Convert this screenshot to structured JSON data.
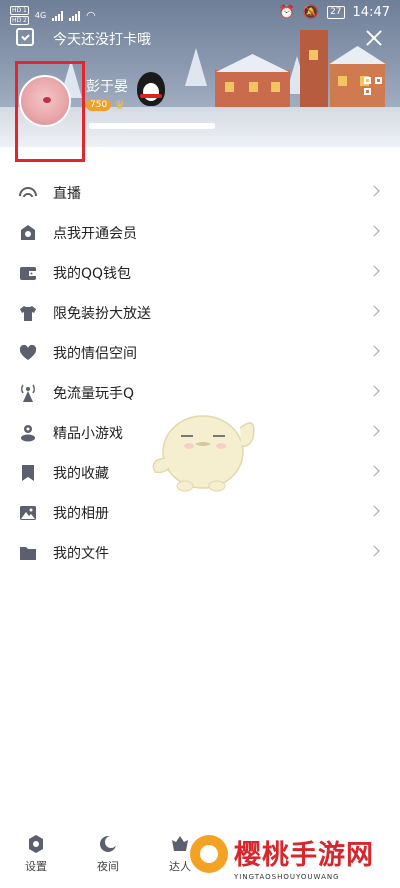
{
  "status_bar": {
    "sim1": "HD 1",
    "sim2": "HD 2",
    "network": "4G",
    "battery": "27",
    "time": "14:47"
  },
  "header": {
    "checkin_text": "今天还没打卡哦",
    "nickname": "彭于晏",
    "level_badge": "750"
  },
  "menu": {
    "items": [
      {
        "label": "直播",
        "icon": "live-icon"
      },
      {
        "label": "点我开通会员",
        "icon": "vip-icon"
      },
      {
        "label": "我的QQ钱包",
        "icon": "wallet-icon"
      },
      {
        "label": "限免装扮大放送",
        "icon": "shirt-icon"
      },
      {
        "label": "我的情侣空间",
        "icon": "heart-icon"
      },
      {
        "label": "免流量玩手Q",
        "icon": "signal-tower-icon"
      },
      {
        "label": "精品小游戏",
        "icon": "game-icon"
      },
      {
        "label": "我的收藏",
        "icon": "bookmark-icon"
      },
      {
        "label": "我的相册",
        "icon": "photo-icon"
      },
      {
        "label": "我的文件",
        "icon": "folder-icon"
      }
    ]
  },
  "bottom_bar": {
    "settings": "设置",
    "night": "夜间",
    "expert": "达人"
  },
  "watermark": {
    "title": "樱桃手游网",
    "subtitle": "YINGTAOSHOUYOUWANG"
  },
  "colors": {
    "highlight_frame": "#e3252c",
    "icon_gray": "#5b5f6e",
    "watermark_red": "#d8262c"
  }
}
